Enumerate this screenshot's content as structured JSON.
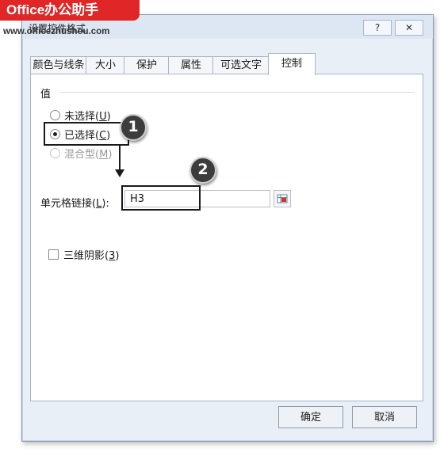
{
  "watermark": {
    "brand": "Office办公助手",
    "url": "www.officezhushou.com"
  },
  "window": {
    "title": "设置控件格式",
    "help_label": "?",
    "close_label": "✕"
  },
  "tabs": [
    {
      "label": "颜色与线条"
    },
    {
      "label": "大小"
    },
    {
      "label": "保护"
    },
    {
      "label": "属性"
    },
    {
      "label": "可选文字"
    },
    {
      "label": "控制",
      "active": true
    }
  ],
  "value_group": {
    "label": "值",
    "options": [
      {
        "text": "未选择",
        "key": "U",
        "checked": false,
        "disabled": false
      },
      {
        "text": "已选择",
        "key": "C",
        "checked": true,
        "disabled": false
      },
      {
        "text": "混合型",
        "key": "M",
        "checked": false,
        "disabled": true
      }
    ]
  },
  "cell_link": {
    "label": "单元格链接",
    "key": "L",
    "colon": ":",
    "value": "H3"
  },
  "shading": {
    "label": "三维阴影",
    "key": "3",
    "checked": false
  },
  "annotations": {
    "badge1": "1",
    "badge2": "2"
  },
  "footer": {
    "ok_label": "确定",
    "cancel_label": "取消"
  }
}
